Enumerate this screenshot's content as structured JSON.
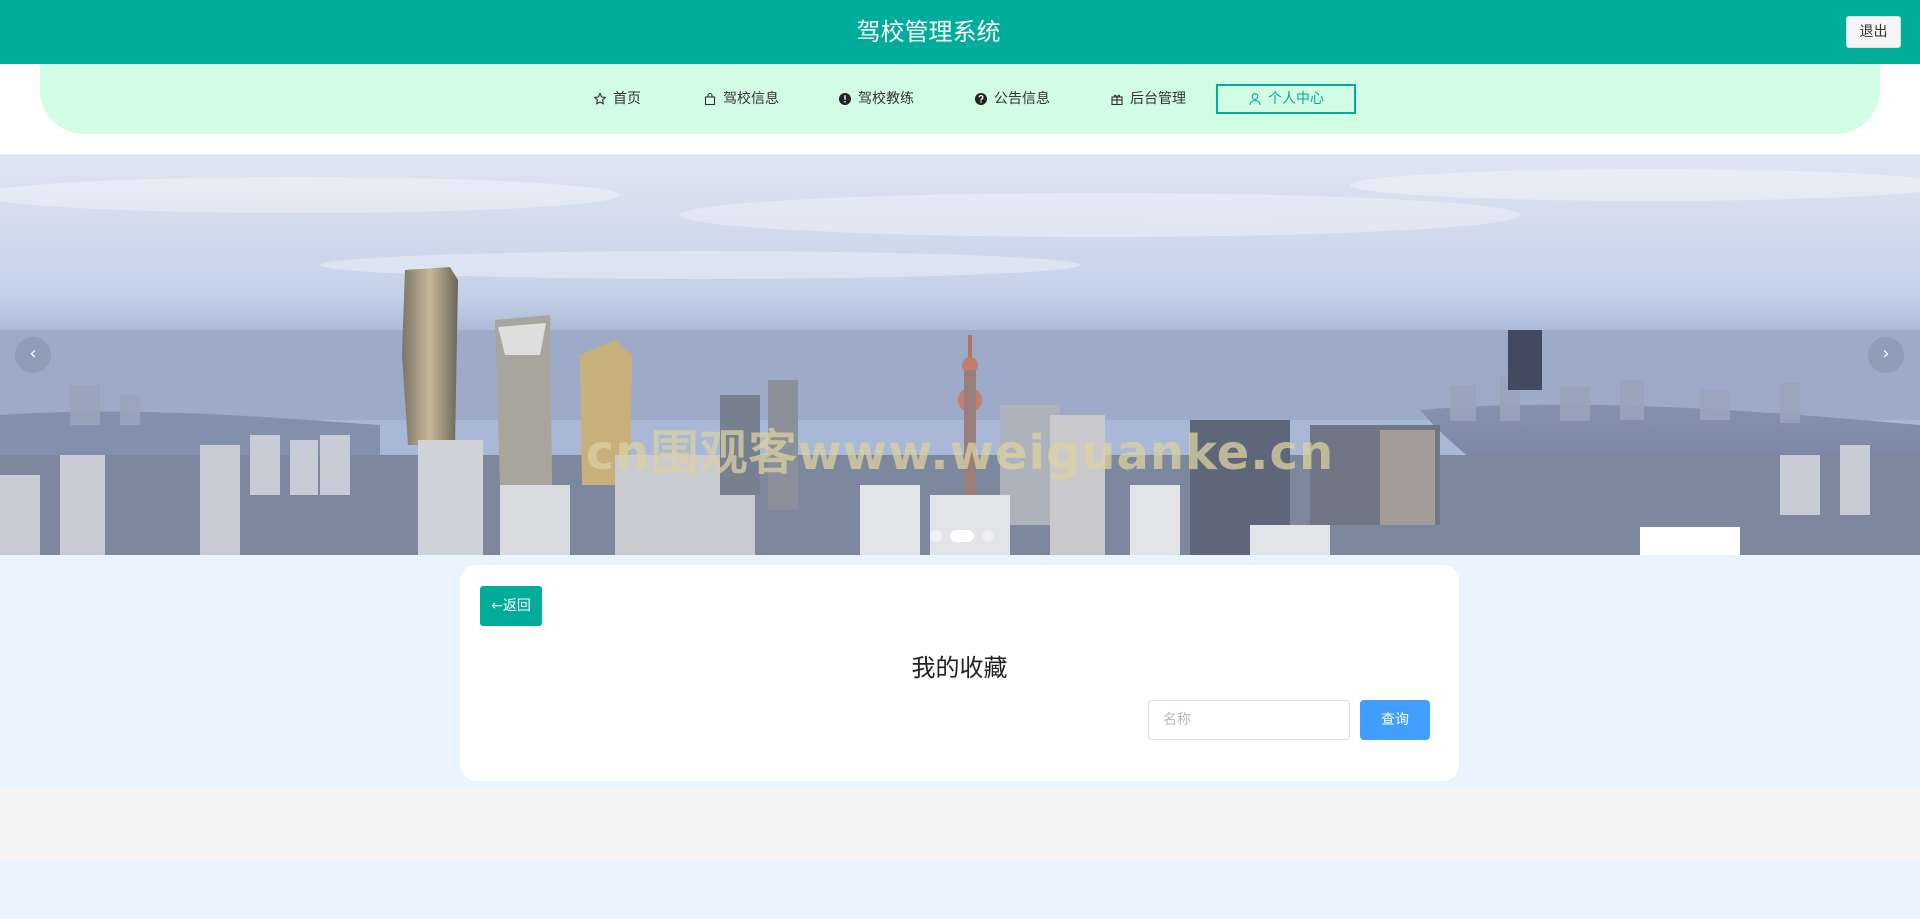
{
  "header": {
    "title": "驾校管理系统",
    "logout_label": "退出"
  },
  "nav": {
    "items": [
      {
        "label": "首页",
        "icon": "star-icon"
      },
      {
        "label": "驾校信息",
        "icon": "bag-icon"
      },
      {
        "label": "驾校教练",
        "icon": "warning-circle-icon"
      },
      {
        "label": "公告信息",
        "icon": "question-circle-icon"
      },
      {
        "label": "后台管理",
        "icon": "gift-icon"
      },
      {
        "label": "个人中心",
        "icon": "user-icon",
        "active": true
      }
    ]
  },
  "banner": {
    "watermark": "cn围观客www.weiguanke.cn",
    "prev_label": "‹",
    "next_label": "›",
    "slide_count": 3,
    "active_slide": 2
  },
  "content": {
    "back_label": "←返回",
    "page_title": "我的收藏",
    "search": {
      "placeholder": "名称",
      "value": ""
    },
    "query_label": "查询"
  },
  "colors": {
    "primary": "#00ad9b",
    "nav_bg": "#d2fce4",
    "query_blue": "#409eff",
    "page_bg": "#eaf4fe"
  }
}
